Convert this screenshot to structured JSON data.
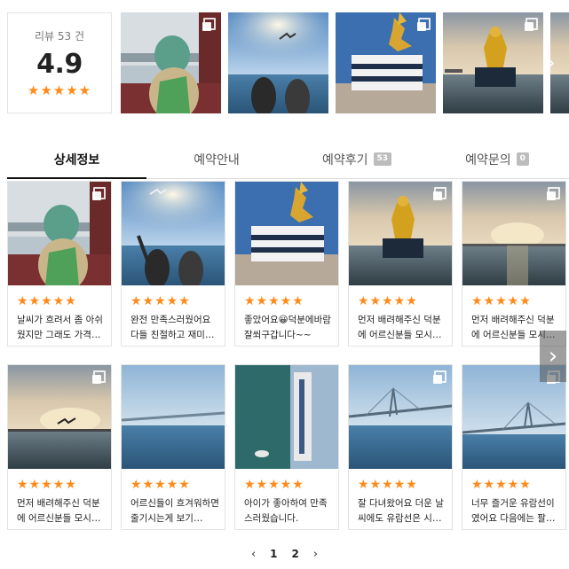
{
  "summary": {
    "count_label": "리뷰 53 건",
    "score": "4.9",
    "stars": "★★★★★"
  },
  "top_strip": {
    "next_icon": "chevron-right-icon"
  },
  "tabs": [
    {
      "label": "상세정보",
      "badge": ""
    },
    {
      "label": "예약안내",
      "badge": ""
    },
    {
      "label": "예약후기",
      "badge": "53"
    },
    {
      "label": "예약문의",
      "badge": "0"
    }
  ],
  "reviews": [
    {
      "stars": "★★★★★",
      "text": "날씨가 흐려서 좀 아쉬웠지만 그래도 가격…"
    },
    {
      "stars": "★★★★★",
      "text": "완전 만족스러웠어요 다들 친절하고 재미…"
    },
    {
      "stars": "★★★★★",
      "text": "좋았어요😀덕분에바람잘쐬구갑니다~~"
    },
    {
      "stars": "★★★★★",
      "text": "먼저 배려해주신 덕분에 어르신분들 모시…"
    },
    {
      "stars": "★★★★★",
      "text": "먼저 배려해주신 덕분에 어르신분들 모시…"
    },
    {
      "stars": "★★★★★",
      "text": "먼저 배려해주신 덕분에 어르신분들 모시…"
    },
    {
      "stars": "★★★★★",
      "text": "어르신들이 흐겨워하면 줄기시는게 보기…"
    },
    {
      "stars": "★★★★★",
      "text": "아이가 좋아하여 만족스러웠습니다."
    },
    {
      "stars": "★★★★★",
      "text": "잘 다녀왔어요 더운 날씨에도 유람선은 시…"
    },
    {
      "stars": "★★★★★",
      "text": "너무 즐거운 유람선이였어요 다음에는 팔…"
    }
  ],
  "pagination": {
    "prev": "‹",
    "pages": [
      "1",
      "2"
    ],
    "next": "›"
  },
  "colors": {
    "star": "#ff8a1a",
    "border": "#e3e3e3",
    "badge": "#bdbdbd"
  }
}
